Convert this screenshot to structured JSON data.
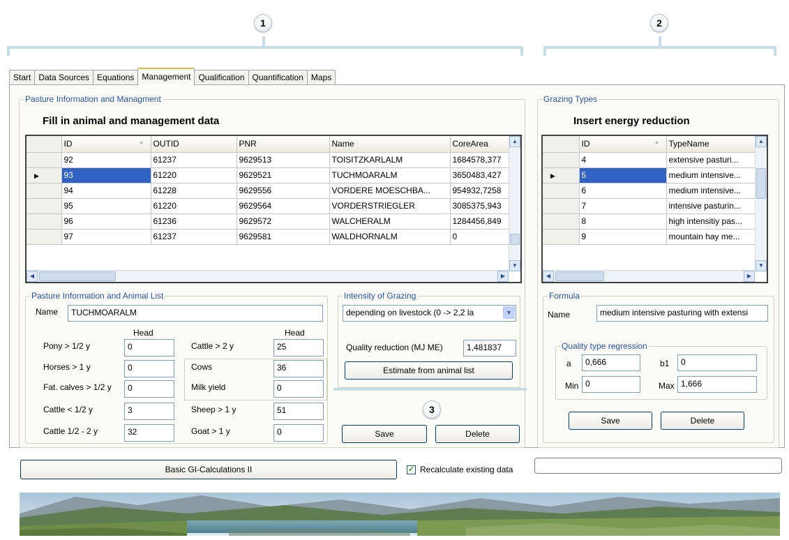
{
  "callouts": [
    "1",
    "2",
    "3"
  ],
  "tabs": [
    "Start",
    "Data Sources",
    "Equations",
    "Management",
    "Qualification",
    "Quantification",
    "Maps"
  ],
  "active_tab": "Management",
  "pasture": {
    "group_title": "Pasture Information and Managment",
    "heading": "Fill in animal and management  data",
    "columns": [
      "ID",
      "OUTID",
      "PNR",
      "Name",
      "CoreArea"
    ],
    "rows": [
      [
        "92",
        "61237",
        "9629513",
        "TOISITZKARLALM",
        "1684578,377"
      ],
      [
        "93",
        "61220",
        "9629521",
        "TUCHMOARALM",
        "3650483,427"
      ],
      [
        "94",
        "61228",
        "9629556",
        "VORDERE MOESCHBA...",
        "954932,7258"
      ],
      [
        "95",
        "61220",
        "9629564",
        "VORDERSTRIEGLER",
        "3085375,943"
      ],
      [
        "96",
        "61236",
        "9629572",
        "WALCHERALM",
        "1284456,849"
      ],
      [
        "97",
        "61237",
        "9629581",
        "WALDHORNALM",
        "0"
      ]
    ],
    "selected_row": 1
  },
  "animal_list": {
    "group_title": "Pasture Information and Animal List",
    "name_label": "Name",
    "name_value": "TUCHMOARALM",
    "head_label": "Head",
    "left": [
      {
        "label": "Pony > 1/2 y",
        "value": "0"
      },
      {
        "label": "Horses > 1 y",
        "value": "0"
      },
      {
        "label": "Fat. calves > 1/2 y",
        "value": "0"
      },
      {
        "label": "Cattle < 1/2 y",
        "value": "3"
      },
      {
        "label": "Cattle  1/2 - 2 y",
        "value": "32"
      }
    ],
    "right": [
      {
        "label": "Cattle > 2 y",
        "value": "25"
      },
      {
        "label": "Cows",
        "value": "36"
      },
      {
        "label": "Milk yield",
        "value": "0"
      },
      {
        "label": "Sheep > 1 y",
        "value": "51"
      },
      {
        "label": "Goat > 1 y",
        "value": "0"
      }
    ]
  },
  "intensity": {
    "group_title": "Intensity of Grazing",
    "combo_value": "depending on livestock  (0  -> 2,2 la",
    "quality_label": "Quality reduction  (MJ ME)",
    "quality_value": "1,481837",
    "estimate_button": "Estimate from animal list"
  },
  "mgmt_buttons": {
    "save": "Save",
    "delete": "Delete"
  },
  "basic_button": "Basic GI-Calculations II",
  "recalc": {
    "label": "Recalculate existing data",
    "checked": true
  },
  "grazing": {
    "group_title": "Grazing Types",
    "heading": "Insert energy reduction",
    "columns": [
      "ID",
      "TypeName"
    ],
    "rows": [
      [
        "4",
        "extensive pasturi..."
      ],
      [
        "5",
        "medium intensive..."
      ],
      [
        "6",
        "medium intensive..."
      ],
      [
        "7",
        "intensive pasturin..."
      ],
      [
        "8",
        "high intensitiy pas..."
      ],
      [
        "9",
        "mountain hay me..."
      ]
    ],
    "selected_row": 1
  },
  "formula": {
    "group_title": "Formula",
    "name_label": "Name",
    "name_value": "medium intensive pasturing with extensi",
    "regression_title": "Quality type regression",
    "a_label": "a",
    "a_value": "0,666",
    "b1_label": "b1",
    "b1_value": "0",
    "min_label": "Min",
    "min_value": "0",
    "max_label": "Max",
    "max_value": "1,666",
    "save": "Save",
    "delete": "Delete"
  },
  "icons": {
    "row_pointer": "row-pointer-icon",
    "checkmark": "checkmark-icon"
  },
  "colors": {
    "selection": "#3163c5",
    "group_title": "#2851a8",
    "active_tab_accent": "#f0b43c",
    "callout_bracket": "#c9dde6"
  }
}
